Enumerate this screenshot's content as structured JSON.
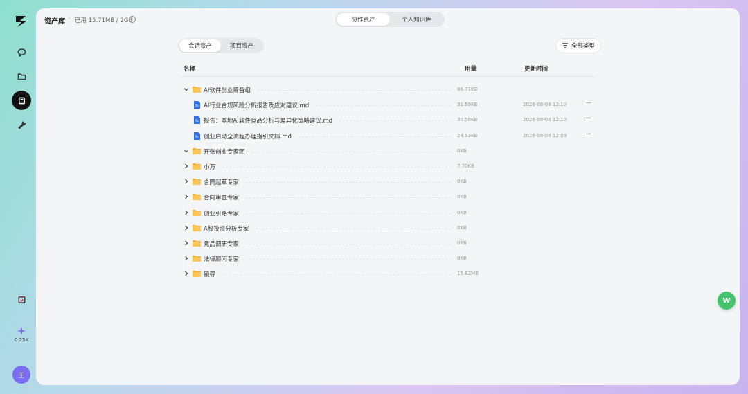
{
  "header": {
    "title": "资产库",
    "separator": "›",
    "usage": "已用 15.71MB / 2GB",
    "info": "i"
  },
  "top_tabs": [
    {
      "label": "协作资产",
      "active": true
    },
    {
      "label": "个人知识库",
      "active": false
    }
  ],
  "sub_tabs": [
    {
      "label": "会话资产",
      "active": true
    },
    {
      "label": "项目资产",
      "active": false
    }
  ],
  "filter": {
    "label": "全部类型",
    "icon": "filter-icon"
  },
  "columns": {
    "name": "名称",
    "size": "用量",
    "updated": "更新时间"
  },
  "rows": [
    {
      "type": "folder",
      "name": "AI软件创业筹备组",
      "size": "86.71KB",
      "expanded": true,
      "updated": ""
    },
    {
      "type": "file",
      "name": "AI行业合规风险分析报告及应对建议.md",
      "size": "31.59KB",
      "updated": "2026-08-08 12:10",
      "more": "···"
    },
    {
      "type": "file",
      "name": "报告：本地AI软件竞品分析与差异化策略建议.md",
      "size": "30.58KB",
      "updated": "2026-08-08 12:10",
      "more": "···"
    },
    {
      "type": "file",
      "name": "创业启动全流程办理指引文档.md",
      "size": "24.53KB",
      "updated": "2026-08-08 12:09",
      "more": "···"
    },
    {
      "type": "folder",
      "name": "开张创业专家团",
      "size": "0KB",
      "expanded": true,
      "updated": ""
    },
    {
      "type": "folder",
      "name": "小万",
      "size": "7.70KB",
      "expanded": false,
      "updated": ""
    },
    {
      "type": "folder",
      "name": "合同起草专家",
      "size": "0KB",
      "expanded": false,
      "updated": ""
    },
    {
      "type": "folder",
      "name": "合同审查专家",
      "size": "0KB",
      "expanded": false,
      "updated": ""
    },
    {
      "type": "folder",
      "name": "创业引路专家",
      "size": "0KB",
      "expanded": false,
      "updated": ""
    },
    {
      "type": "folder",
      "name": "A股投资分析专家",
      "size": "0KB",
      "expanded": false,
      "updated": ""
    },
    {
      "type": "folder",
      "name": "竞品调研专家",
      "size": "0KB",
      "expanded": false,
      "updated": ""
    },
    {
      "type": "folder",
      "name": "法律顾问专家",
      "size": "0KB",
      "expanded": false,
      "updated": ""
    },
    {
      "type": "folder",
      "name": "镜导",
      "size": "15.62MB",
      "expanded": false,
      "updated": ""
    }
  ],
  "sidebar": {
    "items": [
      {
        "icon": "chat-icon"
      },
      {
        "icon": "folder-icon"
      },
      {
        "icon": "book-icon",
        "active": true
      },
      {
        "icon": "wrench-icon"
      }
    ],
    "task_icon": "task-icon",
    "credits": "0.25K",
    "avatar": "王"
  },
  "fab": {
    "label": "W"
  },
  "colors": {
    "accent": "#7b6cf0",
    "folder": "#f6b23c",
    "doc": "#2f6fe4",
    "fab": "#46c36f"
  }
}
